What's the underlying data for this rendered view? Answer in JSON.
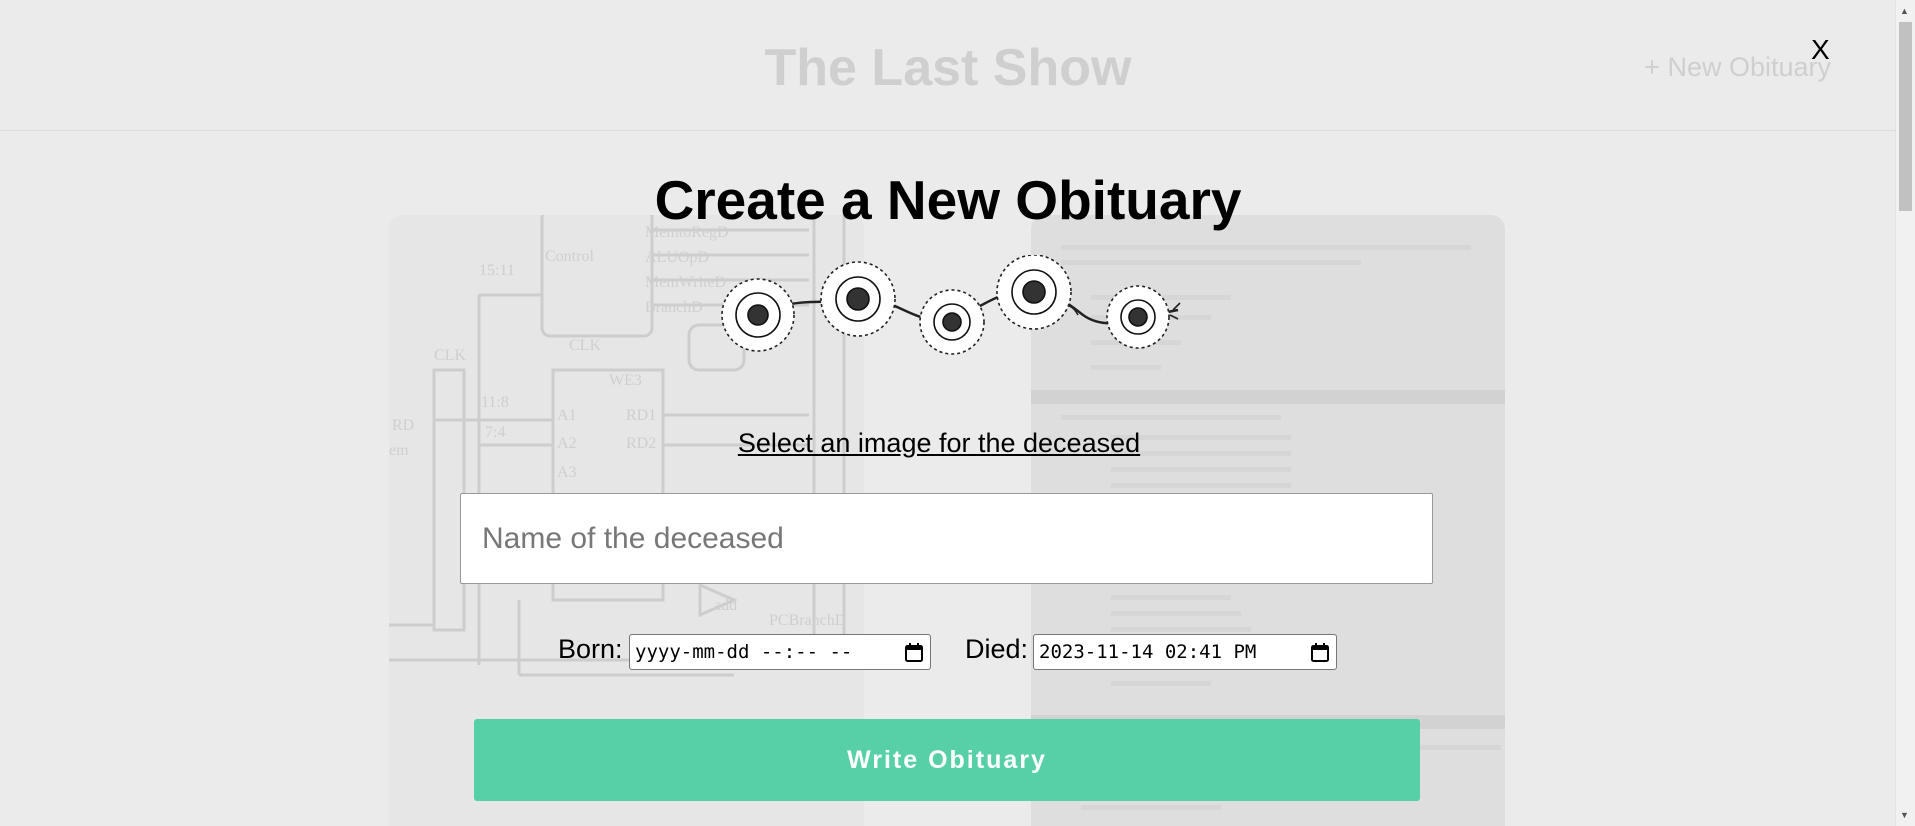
{
  "background": {
    "title": "The Last Show",
    "new_obituary": "+ New Obituary"
  },
  "modal": {
    "close": "X",
    "title": "Create a New Obituary",
    "select_image": "Select an image for the deceased",
    "name_placeholder": "Name of the deceased",
    "born_label": "Born:",
    "born_value": "yyyy-mm-dd --:-- --",
    "died_label": "Died:",
    "died_value": "2023-11-14 02:41 PM",
    "submit": "Write Obituary"
  },
  "colors": {
    "accent": "#57d0a7"
  },
  "icons": {
    "calendar": "calendar-icon",
    "flowers": "daisy-garland"
  }
}
